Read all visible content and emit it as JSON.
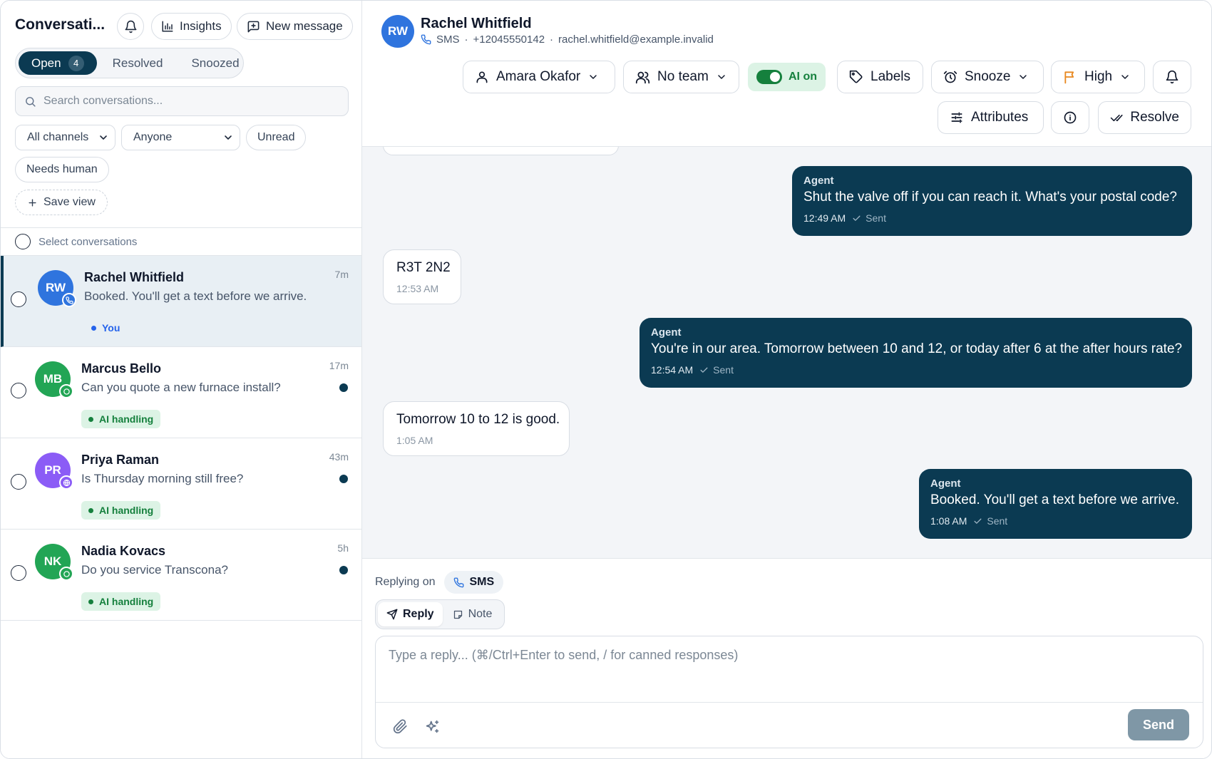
{
  "sidebar": {
    "title": "Conversati...",
    "insights_label": "Insights",
    "new_message_label": "New message",
    "tabs": [
      {
        "label": "Open",
        "count": "4"
      },
      {
        "label": "Resolved"
      },
      {
        "label": "Snoozed"
      }
    ],
    "search_placeholder": "Search conversations...",
    "filters": {
      "channels": "All channels",
      "assignee": "Anyone",
      "unread": "Unread",
      "needs_human": "Needs human",
      "save_view": "Save view"
    },
    "select_label": "Select conversations",
    "conversations": [
      {
        "initials": "RW",
        "name": "Rachel Whitfield",
        "preview": "Booked. You'll get a text before we arrive.",
        "time": "7m",
        "tag": "You",
        "avatar_color": "#2f74de",
        "channel_icon": "phone-icon"
      },
      {
        "initials": "MB",
        "name": "Marcus Bello",
        "preview": "Can you quote a new furnace install?",
        "time": "17m",
        "tag": "AI handling",
        "avatar_color": "#22a555",
        "channel_icon": "whatsapp-icon"
      },
      {
        "initials": "PR",
        "name": "Priya Raman",
        "preview": "Is Thursday morning still free?",
        "time": "43m",
        "tag": "AI handling",
        "avatar_color": "#8b5cf6",
        "channel_icon": "globe-icon"
      },
      {
        "initials": "NK",
        "name": "Nadia Kovacs",
        "preview": "Do you service Transcona?",
        "time": "5h",
        "tag": "AI handling",
        "avatar_color": "#22a555",
        "channel_icon": "whatsapp-icon"
      }
    ]
  },
  "header": {
    "initials": "RW",
    "name": "Rachel Whitfield",
    "channel": "SMS",
    "phone": "+12045550142",
    "email": "rachel.whitfield@example.invalid",
    "assignee": "Amara Okafor",
    "team": "No team",
    "ai_label": "AI on",
    "labels": "Labels",
    "snooze": "Snooze",
    "priority": "High",
    "attributes": "Attributes",
    "resolve": "Resolve"
  },
  "thread": {
    "messages": [
      {
        "direction": "out",
        "sender": "Agent",
        "text": "Shut the valve off if you can reach it. What's your postal code?",
        "time": "12:49 AM",
        "status": "Sent"
      },
      {
        "direction": "in",
        "text": "R3T 2N2",
        "time": "12:53 AM"
      },
      {
        "direction": "out",
        "sender": "Agent",
        "text": "You're in our area. Tomorrow between 10 and 12, or today after 6 at the after hours rate?",
        "time": "12:54 AM",
        "status": "Sent"
      },
      {
        "direction": "in",
        "text": "Tomorrow 10 to 12 is good.",
        "time": "1:05 AM"
      },
      {
        "direction": "out",
        "sender": "Agent",
        "text": "Booked. You'll get a text before we arrive.",
        "time": "1:08 AM",
        "status": "Sent"
      }
    ]
  },
  "composer": {
    "replying_on": "Replying on",
    "channel": "SMS",
    "reply_tab": "Reply",
    "note_tab": "Note",
    "placeholder": "Type a reply... (⌘/Ctrl+Enter to send, / for canned responses)",
    "send": "Send"
  },
  "colors": {
    "brand_dark": "#0b3a52",
    "ai_green": "#15803d",
    "ai_green_bg": "#dcf3e5",
    "priority_orange": "#e8871e",
    "you_blue": "#2563eb"
  }
}
